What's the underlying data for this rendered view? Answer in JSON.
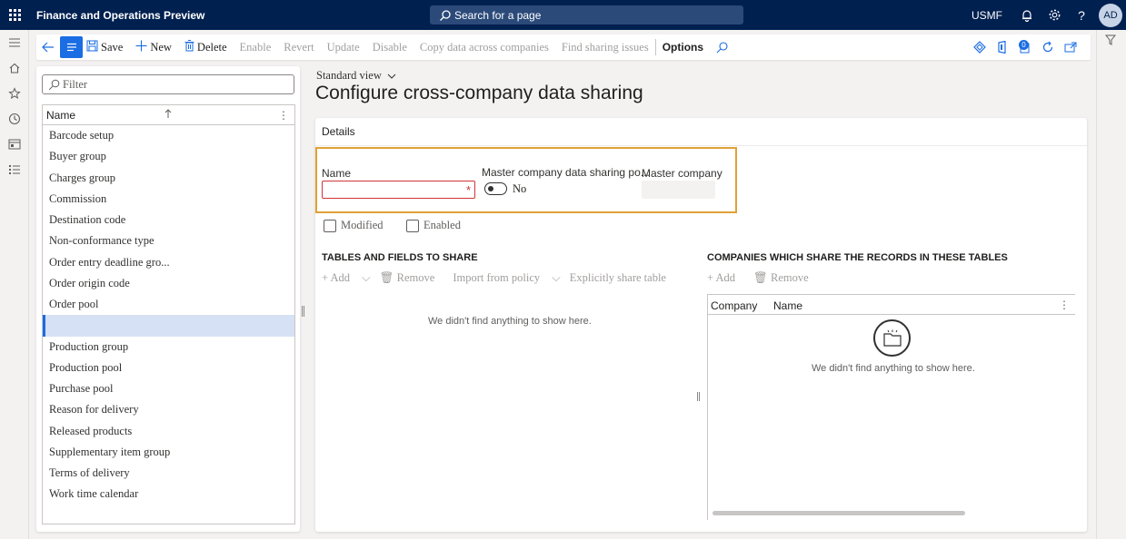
{
  "topbar": {
    "app_title": "Finance and Operations Preview",
    "search_placeholder": "Search for a page",
    "company": "USMF",
    "avatar_initials": "AD"
  },
  "actions": {
    "save": "Save",
    "new": "New",
    "delete": "Delete",
    "enable": "Enable",
    "revert": "Revert",
    "update": "Update",
    "disable": "Disable",
    "copy_data": "Copy data across companies",
    "find_issues": "Find sharing issues",
    "options": "Options",
    "notification_count": "0"
  },
  "list": {
    "filter_placeholder": "Filter",
    "column_header": "Name",
    "items": [
      "Barcode setup",
      "Buyer group",
      "Charges group",
      "Commission",
      "Destination code",
      "Non-conformance type",
      "Order entry deadline gro...",
      "Order origin code",
      "Order pool",
      "",
      "Production group",
      "Production pool",
      "Purchase pool",
      "Reason for delivery",
      "Released products",
      "Supplementary item group",
      "Terms of delivery",
      "Work time calendar"
    ],
    "selected_index": 9
  },
  "main": {
    "view_selector": "Standard view",
    "page_title": "Configure cross-company data sharing",
    "details_header": "Details",
    "fields": {
      "name_label": "Name",
      "name_value": "",
      "master_policy_label": "Master company data sharing po...",
      "master_policy_value": "No",
      "master_company_label": "Master company",
      "master_company_value": ""
    },
    "checkboxes": {
      "modified": "Modified",
      "enabled": "Enabled"
    },
    "tables_section": {
      "title": "TABLES AND FIELDS TO SHARE",
      "add": "Add",
      "remove": "Remove",
      "import": "Import from policy",
      "explicit": "Explicitly share table",
      "empty": "We didn't find anything to show here."
    },
    "companies_section": {
      "title": "COMPANIES WHICH SHARE THE RECORDS IN THESE TABLES",
      "add": "Add",
      "remove": "Remove",
      "col_company": "Company",
      "col_name": "Name",
      "empty": "We didn't find anything to show here."
    }
  },
  "colors": {
    "navbar": "#002050",
    "accent": "#1a6de3",
    "highlight_border": "#e0a136",
    "required": "#d13438"
  }
}
